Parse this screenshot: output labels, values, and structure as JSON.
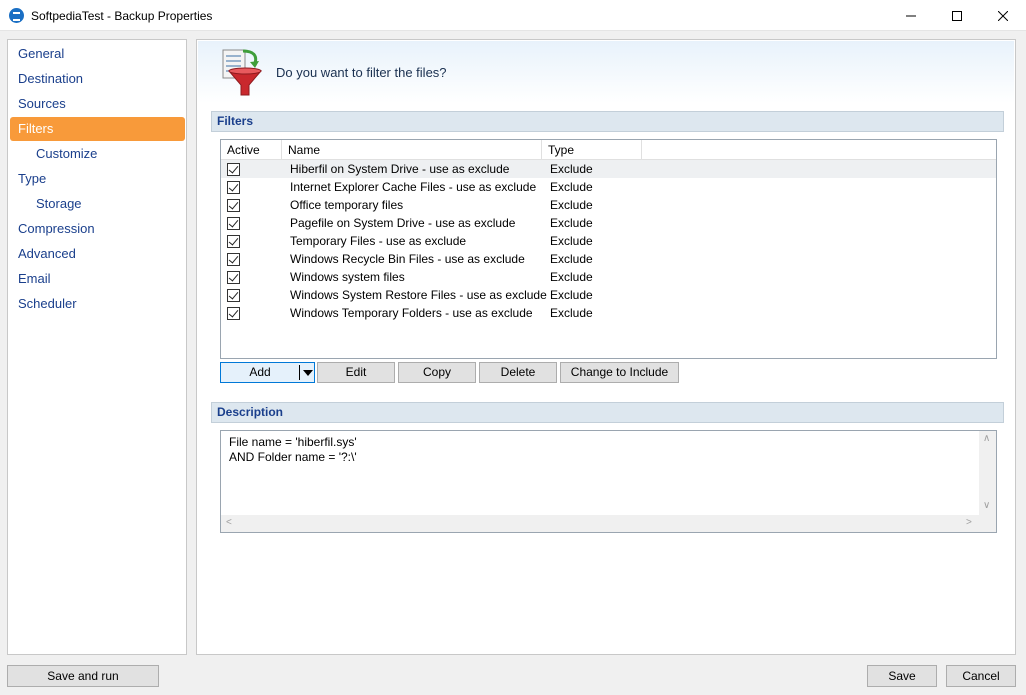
{
  "window": {
    "title": "SoftpediaTest - Backup Properties"
  },
  "nav": {
    "items": [
      {
        "label": "General",
        "sub": false,
        "active": false
      },
      {
        "label": "Destination",
        "sub": false,
        "active": false
      },
      {
        "label": "Sources",
        "sub": false,
        "active": false
      },
      {
        "label": "Filters",
        "sub": false,
        "active": true
      },
      {
        "label": "Customize",
        "sub": true,
        "active": false
      },
      {
        "label": "Type",
        "sub": false,
        "active": false
      },
      {
        "label": "Storage",
        "sub": true,
        "active": false
      },
      {
        "label": "Compression",
        "sub": false,
        "active": false
      },
      {
        "label": "Advanced",
        "sub": false,
        "active": false
      },
      {
        "label": "Email",
        "sub": false,
        "active": false
      },
      {
        "label": "Scheduler",
        "sub": false,
        "active": false
      }
    ]
  },
  "header": {
    "question": "Do you want to filter the files?"
  },
  "filters": {
    "section_title": "Filters",
    "columns": [
      "Active",
      "Name",
      "Type"
    ],
    "rows": [
      {
        "active": true,
        "name": "Hiberfil on System Drive - use as exclude",
        "type": "Exclude"
      },
      {
        "active": true,
        "name": "Internet Explorer Cache Files - use as exclude",
        "type": "Exclude"
      },
      {
        "active": true,
        "name": "Office temporary files",
        "type": "Exclude"
      },
      {
        "active": true,
        "name": "Pagefile on System Drive - use as exclude",
        "type": "Exclude"
      },
      {
        "active": true,
        "name": "Temporary Files - use as exclude",
        "type": "Exclude"
      },
      {
        "active": true,
        "name": "Windows Recycle Bin Files - use as exclude",
        "type": "Exclude"
      },
      {
        "active": true,
        "name": "Windows system files",
        "type": "Exclude"
      },
      {
        "active": true,
        "name": "Windows System Restore Files - use as exclude",
        "type": "Exclude"
      },
      {
        "active": true,
        "name": "Windows Temporary Folders - use as exclude",
        "type": "Exclude"
      }
    ],
    "buttons": {
      "add": "Add",
      "edit": "Edit",
      "copy": "Copy",
      "delete": "Delete",
      "change": "Change to Include"
    }
  },
  "description": {
    "section_title": "Description",
    "line1": "File name = 'hiberfil.sys'",
    "line2": "AND Folder name = '?:\\'"
  },
  "footer": {
    "save_and_run": "Save and run",
    "save": "Save",
    "cancel": "Cancel"
  },
  "colors": {
    "accent_active_nav": "#f89a3a",
    "nav_text": "#1a3f8c",
    "section_bar": "#dde7ef"
  }
}
